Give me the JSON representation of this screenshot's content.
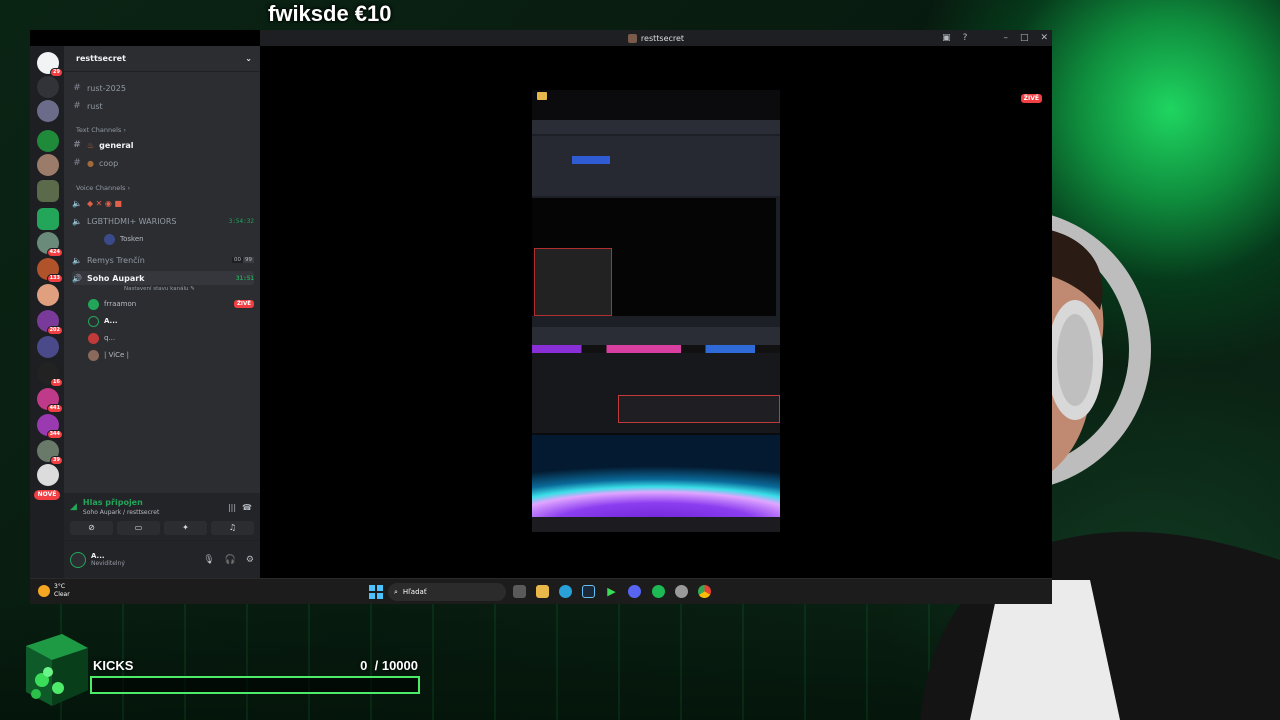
{
  "overlay": {
    "donation_text": "fwiksde €10",
    "kicks_label": "KICKS",
    "kicks_current": "0",
    "kicks_goal": "/ 10000",
    "kicks_progress": 0
  },
  "window": {
    "title": "resttsecret",
    "live_badge": "ŽIVĚ"
  },
  "rail": {
    "badges": [
      "29",
      "424",
      "133",
      "202",
      "16",
      "441",
      "344",
      "39"
    ],
    "new_label": "NOVÉ"
  },
  "server": {
    "name": "resttsecret",
    "top_channels": [
      "rust-2025",
      "rust"
    ],
    "text_category": "Text Channels",
    "text_channels": [
      "general",
      "coop"
    ],
    "voice_category": "Voice Channels",
    "voice_channels": [
      {
        "name": "LGBTHDMI+ WARIORS",
        "time": "3:54:32"
      },
      {
        "name": "Remys Trenčín",
        "count_a": "00",
        "count_b": "99"
      },
      {
        "name": "Soho Aupark",
        "time": "31:51",
        "status": "Nastavení stavu kanálu"
      }
    ],
    "voice_users_1": [
      "Tosken"
    ],
    "voice_users_3": [
      {
        "name": "frraamon",
        "live": "ŽIVĚ"
      },
      {
        "name": "A..."
      },
      {
        "name": "q..."
      },
      {
        "name": "| ViCe |"
      }
    ]
  },
  "voice_panel": {
    "connected": "Hlas připojen",
    "location": "Soho Aupark / resttsecret"
  },
  "user_panel": {
    "name": "A...",
    "status": "Neviditelný"
  },
  "taskbar": {
    "temp": "3°C",
    "weather": "Clear",
    "search_placeholder": "Hľadať"
  },
  "colors": {
    "discord_bg": "#2b2d31",
    "accent_green": "#23a55a",
    "live_red": "#f23f43",
    "kicks_green": "#4eea6a"
  }
}
